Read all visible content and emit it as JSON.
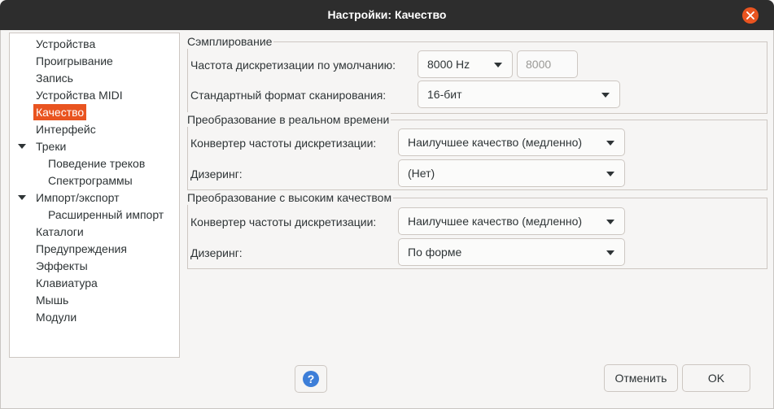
{
  "window": {
    "title": "Настройки: Качество",
    "close_icon": "close-icon",
    "close_color": "#e95420"
  },
  "sidebar": {
    "items": [
      {
        "label": "Устройства"
      },
      {
        "label": "Проигрывание"
      },
      {
        "label": "Запись"
      },
      {
        "label": "Устройства MIDI"
      },
      {
        "label": "Качество",
        "selected": true
      },
      {
        "label": "Интерфейс"
      },
      {
        "label": "Треки",
        "expanded": true
      },
      {
        "label": "Поведение треков"
      },
      {
        "label": "Спектрограммы"
      },
      {
        "label": "Импорт/экспорт",
        "expanded": true
      },
      {
        "label": "Расширенный импорт"
      },
      {
        "label": "Каталоги"
      },
      {
        "label": "Предупреждения"
      },
      {
        "label": "Эффекты"
      },
      {
        "label": "Клавиатура"
      },
      {
        "label": "Мышь"
      },
      {
        "label": "Модули"
      }
    ]
  },
  "sampling": {
    "title": "Сэмплирование",
    "rate_label": "Частота дискретизации по умолчанию:",
    "rate_value": "8000 Hz",
    "rate_custom_value": "8000",
    "format_label": "Стандартный формат сканирования:",
    "format_value": "16-бит"
  },
  "realtime": {
    "title": "Преобразование в реальном времени",
    "converter_label": "Конвертер частоты дискретизации:",
    "converter_value": "Наилучшее качество (медленно)",
    "dither_label": "Дизеринг:",
    "dither_value": "(Нет)"
  },
  "highquality": {
    "title": "Преобразование с высоким качеством",
    "converter_label": "Конвертер частоты дискретизации:",
    "converter_value": "Наилучшее качество (медленно)",
    "dither_label": "Дизеринг:",
    "dither_value": "По форме"
  },
  "footer": {
    "help_label": "?",
    "help_color": "#3d7ed8",
    "cancel_label": "Отменить",
    "ok_label": "OK"
  },
  "colors": {
    "accent": "#e95420",
    "titlebar": "#2d2d2d",
    "background": "#f6f5f4"
  }
}
